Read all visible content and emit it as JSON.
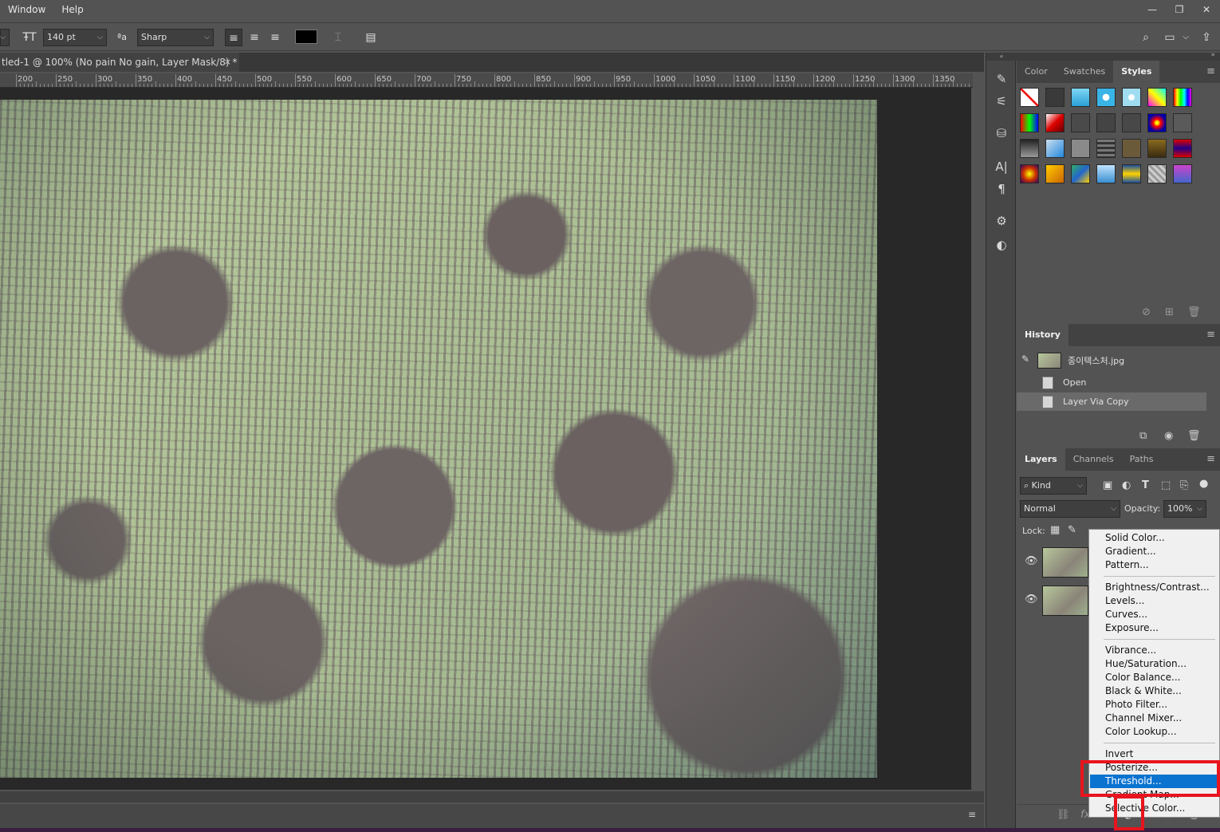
{
  "menubar": {
    "items": [
      "Window",
      "Help"
    ]
  },
  "options": {
    "font_size": "140 pt",
    "aa_label": "ªa",
    "antialias": "Sharp",
    "text_color": "#000000"
  },
  "document": {
    "tab_title": "tled-1 @ 100% (No pain No gain, Layer Mask/8) *",
    "close": "×"
  },
  "ruler": {
    "labels": [
      "200",
      "250",
      "300",
      "350",
      "400",
      "450",
      "500",
      "550",
      "600",
      "650",
      "700",
      "750",
      "800",
      "850",
      "900",
      "950",
      "1000",
      "1050",
      "1100",
      "1150",
      "1200",
      "1250",
      "1300",
      "1350"
    ]
  },
  "styles_panel": {
    "tabs": [
      "Color",
      "Swatches",
      "Styles"
    ],
    "active_tab": "Styles"
  },
  "history_panel": {
    "tab": "History",
    "snapshot": "종이텍스처.jpg",
    "steps": [
      "Open",
      "Layer Via Copy"
    ]
  },
  "layers_panel": {
    "tabs": [
      "Layers",
      "Channels",
      "Paths"
    ],
    "active_tab": "Layers",
    "filter": "Kind",
    "blend_mode": "Normal",
    "opacity_label": "Opacity:",
    "opacity": "100%",
    "lock_label": "Lock:"
  },
  "adjustment_menu": {
    "group1": [
      "Solid Color...",
      "Gradient...",
      "Pattern..."
    ],
    "group2": [
      "Brightness/Contrast...",
      "Levels...",
      "Curves...",
      "Exposure..."
    ],
    "group3": [
      "Vibrance...",
      "Hue/Saturation...",
      "Color Balance...",
      "Black & White...",
      "Photo Filter...",
      "Channel Mixer...",
      "Color Lookup..."
    ],
    "group4": [
      "Invert",
      "Posterize...",
      "Threshold...",
      "Gradient Map...",
      "Selective Color..."
    ],
    "highlighted": "Threshold..."
  },
  "colors": {
    "highlight": "#0a73d0",
    "annotation": "#e8141e"
  }
}
